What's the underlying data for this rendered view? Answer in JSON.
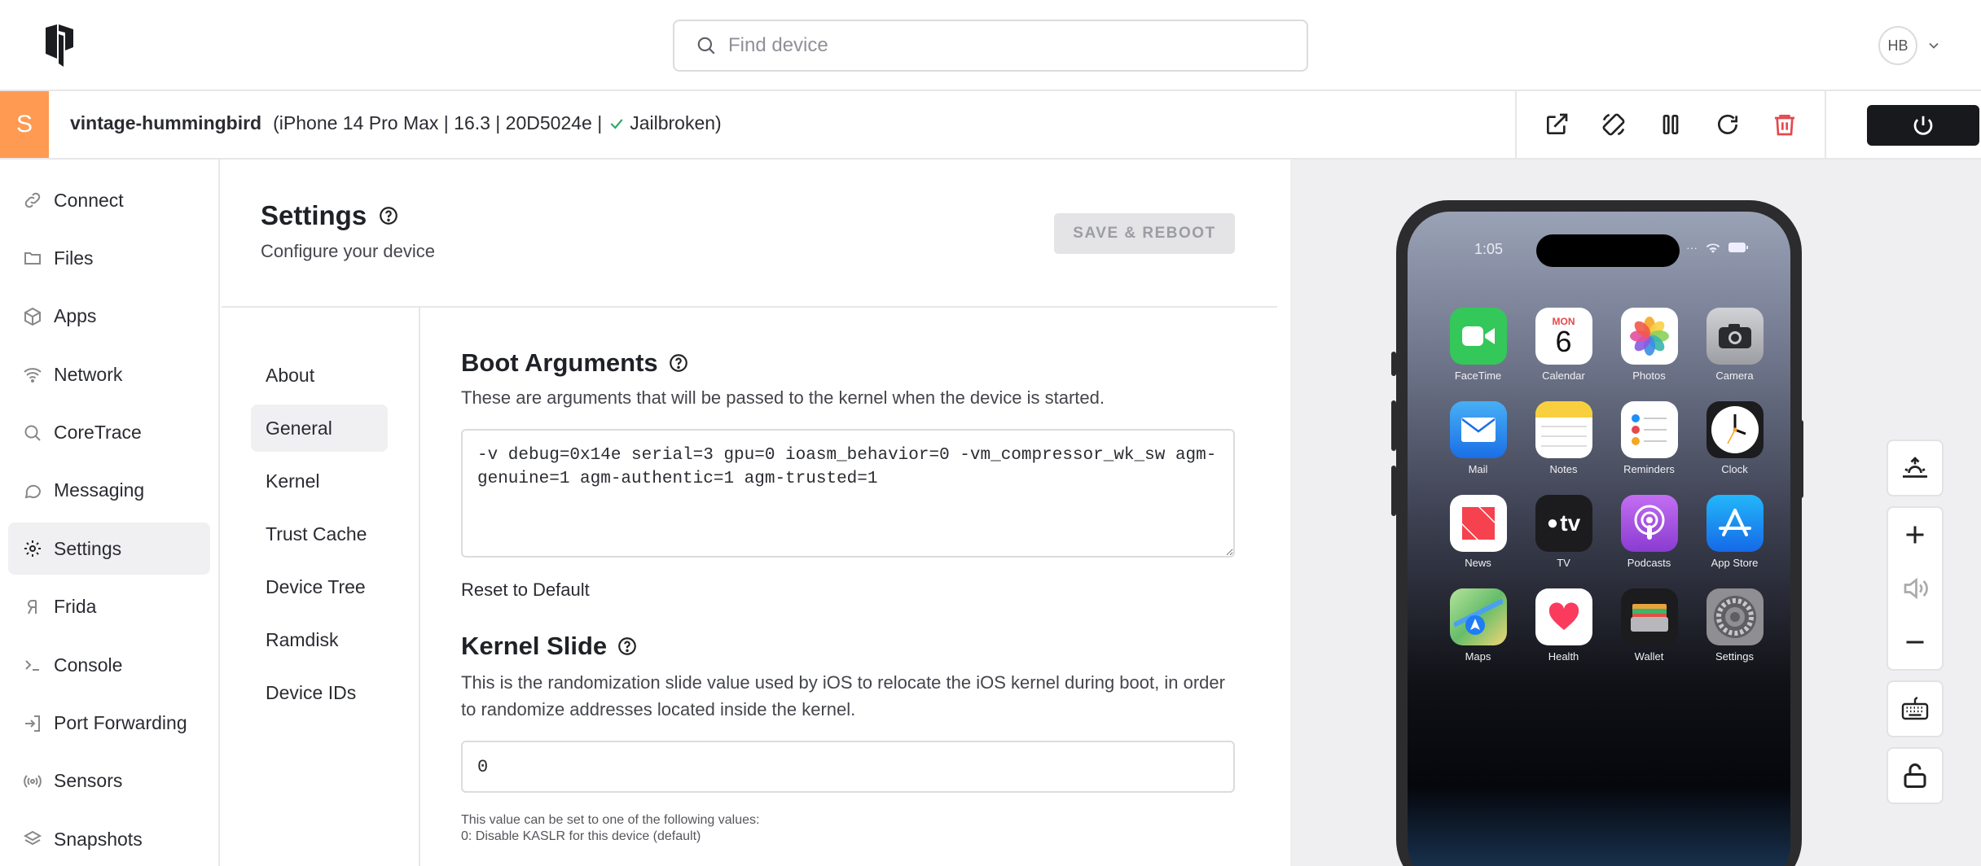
{
  "topbar": {
    "search_placeholder": "Find device",
    "user_initials": "HB"
  },
  "device": {
    "badge": "S",
    "name": "vintage-hummingbird",
    "meta_prefix": "(iPhone 14 Pro Max | 16.3 | 20D5024e |",
    "meta_status": "Jailbroken)",
    "actions": [
      "external-link-icon",
      "rotate-icon",
      "pause-icon",
      "refresh-icon",
      "trash-icon"
    ],
    "power_icon": "power-icon"
  },
  "sidebar": {
    "items": [
      {
        "label": "Connect",
        "icon": "link-icon"
      },
      {
        "label": "Files",
        "icon": "folder-icon"
      },
      {
        "label": "Apps",
        "icon": "cube-icon"
      },
      {
        "label": "Network",
        "icon": "wifi-icon"
      },
      {
        "label": "CoreTrace",
        "icon": "search-icon"
      },
      {
        "label": "Messaging",
        "icon": "message-icon"
      },
      {
        "label": "Settings",
        "icon": "gear-icon",
        "active": true
      },
      {
        "label": "Frida",
        "icon": "frida-icon"
      },
      {
        "label": "Console",
        "icon": "terminal-icon"
      },
      {
        "label": "Port Forwarding",
        "icon": "login-icon"
      },
      {
        "label": "Sensors",
        "icon": "broadcast-icon"
      },
      {
        "label": "Snapshots",
        "icon": "layers-icon"
      }
    ]
  },
  "page": {
    "title": "Settings",
    "subtitle": "Configure your device",
    "save_label": "SAVE & REBOOT"
  },
  "subnav": {
    "items": [
      "About",
      "General",
      "Kernel",
      "Trust Cache",
      "Device Tree",
      "Ramdisk",
      "Device IDs"
    ],
    "active": "General"
  },
  "boot": {
    "title": "Boot Arguments",
    "desc": "These are arguments that will be passed to the kernel when the device is started.",
    "value": "-v debug=0x14e serial=3 gpu=0 ioasm_behavior=0 -vm_compressor_wk_sw agm-genuine=1 agm-authentic=1 agm-trusted=1",
    "reset_label": "Reset to Default"
  },
  "kernel_slide": {
    "title": "Kernel Slide",
    "desc": "This is the randomization slide value used by iOS to relocate the iOS kernel during boot, in order to randomize addresses located inside the kernel.",
    "value": "0",
    "note1": "This value can be set to one of the following values:",
    "note2": "0: Disable KASLR for this device (default)"
  },
  "phone": {
    "time": "1:05",
    "calendar_day": "MON",
    "calendar_date": "6",
    "apps": [
      {
        "label": "FaceTime",
        "icon": "facetime-icon",
        "color": "#34c759"
      },
      {
        "label": "Calendar",
        "icon": "calendar-icon",
        "color": "#ffffff"
      },
      {
        "label": "Photos",
        "icon": "photos-icon",
        "color": "#ffffff"
      },
      {
        "label": "Camera",
        "icon": "camera-icon",
        "color": "#b8b9bd"
      },
      {
        "label": "Mail",
        "icon": "mail-icon",
        "color": "#1f8cf0"
      },
      {
        "label": "Notes",
        "icon": "notes-icon",
        "color": "#ffffff"
      },
      {
        "label": "Reminders",
        "icon": "reminders-icon",
        "color": "#ffffff"
      },
      {
        "label": "Clock",
        "icon": "clock-icon",
        "color": "#1c1c1e"
      },
      {
        "label": "News",
        "icon": "news-icon",
        "color": "#ffffff"
      },
      {
        "label": "TV",
        "icon": "tv-icon",
        "color": "#1c1c1e"
      },
      {
        "label": "Podcasts",
        "icon": "podcasts-icon",
        "color": "#a54ee0"
      },
      {
        "label": "App Store",
        "icon": "appstore-icon",
        "color": "#1e8ff5"
      },
      {
        "label": "Maps",
        "icon": "maps-icon",
        "color": "#7ec77a"
      },
      {
        "label": "Health",
        "icon": "health-icon",
        "color": "#ffffff"
      },
      {
        "label": "Wallet",
        "icon": "wallet-icon",
        "color": "#1c1c1e"
      },
      {
        "label": "Settings",
        "icon": "settings-app-icon",
        "color": "#8e8e93"
      }
    ],
    "tv_label": "tv"
  },
  "tools": [
    "sunrise-icon",
    "plus-icon",
    "volume-icon",
    "minus-icon",
    "keyboard-icon",
    "unlock-icon"
  ],
  "colors": {
    "accent": "#ff9a52",
    "check": "#2faa6a",
    "danger": "#e5484d",
    "dark": "#18191c"
  }
}
